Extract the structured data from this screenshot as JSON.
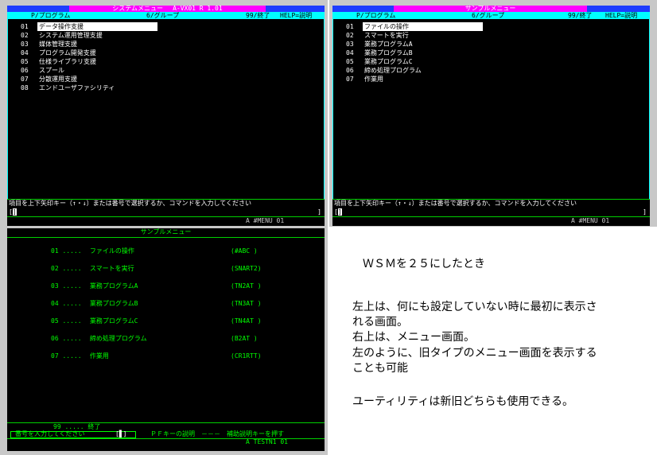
{
  "top_left": {
    "title": "システムメニュー",
    "title_version": "A-VX01   R 1.01",
    "header": {
      "col_program": "P/プログラム",
      "col_group": "6/グループ",
      "exit": "99/終了",
      "help": "HELP=説明"
    },
    "items": [
      {
        "num": "01",
        "label": "データ操作支援",
        "selected": true
      },
      {
        "num": "02",
        "label": "システム運用管理支援"
      },
      {
        "num": "03",
        "label": "媒体管理支援"
      },
      {
        "num": "04",
        "label": "プログラム開発支援"
      },
      {
        "num": "05",
        "label": "仕様ライブラリ支援"
      },
      {
        "num": "06",
        "label": "スプール"
      },
      {
        "num": "07",
        "label": "分散運用支援"
      },
      {
        "num": "08",
        "label": "エンドユーザファシリティ"
      }
    ],
    "instruction": "項目を上下矢印キー（↑・↓）または番号で選択するか、コマンドを入力してください",
    "cmd_open": "[",
    "cmd_cursor": "]",
    "cmd_close": "]",
    "status": "A #MENU  01"
  },
  "top_right": {
    "title": "サンプルメニュー",
    "header": {
      "col_program": "P/プログラム",
      "col_group": "6/グループ",
      "exit": "99/終了",
      "help": "HELP=説明"
    },
    "items": [
      {
        "num": "01",
        "label": "ファイルの操作",
        "selected": true
      },
      {
        "num": "02",
        "label": "スマートを実行"
      },
      {
        "num": "03",
        "label": "業務プログラムA"
      },
      {
        "num": "04",
        "label": "業務プログラムB"
      },
      {
        "num": "05",
        "label": "業務プログラムC"
      },
      {
        "num": "06",
        "label": "締め処理プログラム"
      },
      {
        "num": "07",
        "label": "作業用"
      }
    ],
    "instruction": "項目を上下矢印キー（↑・↓）または番号で選択するか、コマンドを入力してください",
    "cmd_open": "[",
    "cmd_cursor": "]",
    "cmd_close": "]",
    "status": "A #MENU  01"
  },
  "bottom_left": {
    "title": "サンプルメニュー",
    "items": [
      {
        "num": "01",
        "dots": ".....",
        "label": "ファイルの操作",
        "code": "(#ABC  )"
      },
      {
        "num": "02",
        "dots": ".....",
        "label": "スマートを実行",
        "code": "(SNART2)"
      },
      {
        "num": "03",
        "dots": ".....",
        "label": "業務プログラムA",
        "code": "(TN2AT )"
      },
      {
        "num": "04",
        "dots": ".....",
        "label": "業務プログラムB",
        "code": "(TN3AT )"
      },
      {
        "num": "05",
        "dots": ".....",
        "label": "業務プログラムC",
        "code": "(TN4AT )"
      },
      {
        "num": "06",
        "dots": ".....",
        "label": "締め処理プログラム",
        "code": "(B2AT  )"
      },
      {
        "num": "07",
        "dots": ".....",
        "label": "作業用",
        "code": "(CR1RTT)"
      }
    ],
    "exit_item": "99 ..... 終了",
    "input_prompt": "番号を入力してください",
    "input_value": "[▋]",
    "pf_help": "ＰＦキーの説明　－－－　補助説明キーを押す",
    "status": "A TESTN1 01"
  },
  "notes": {
    "heading": "ＷＳＭを２５にしたとき",
    "lines": [
      "左上は、何にも設定していない時に最初に表示さ",
      "れる画面。",
      "右上は、メニュー画面。",
      "左のように、旧タイプのメニュー画面を表示する",
      "ことも可能",
      "",
      "ユーティリティは新旧どちらも使用できる。"
    ]
  }
}
